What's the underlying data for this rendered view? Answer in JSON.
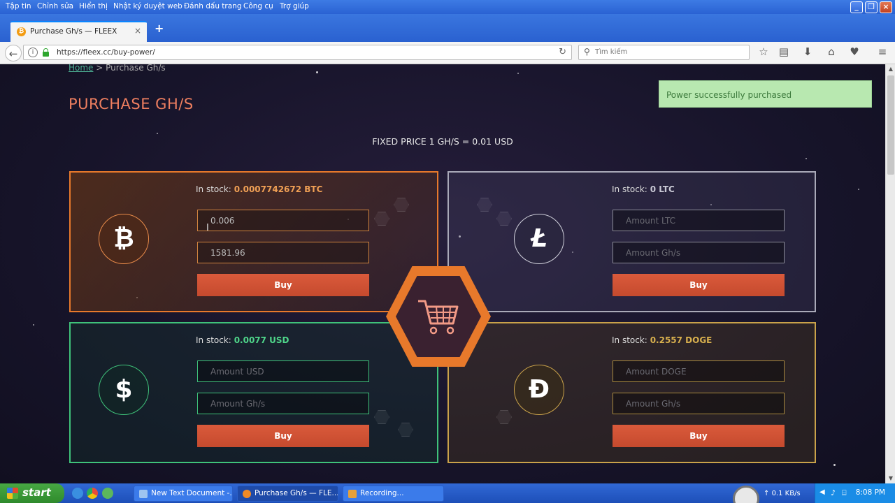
{
  "browser": {
    "menu": [
      "Tập tin",
      "Chỉnh sửa",
      "Hiển thị",
      "Nhật ký duyệt web",
      "Đánh dấu trang",
      "Công cụ",
      "Trợ giúp"
    ],
    "tab_title": "Purchase Gh/s — FLEEX",
    "url": "https://fleex.cc/buy-power/",
    "search_placeholder": "Tìm kiếm"
  },
  "page": {
    "breadcrumb_home": "Home",
    "breadcrumb_sep": ">",
    "breadcrumb_current": "Purchase Gh/s",
    "title": "PURCHASE GH/S",
    "fixed_price": "FIXED PRICE 1 GH/S = 0.01 USD",
    "toast": "Power successfully purchased"
  },
  "cards": {
    "btc": {
      "stock_label": "In stock:",
      "stock_value": "0.0007742672 BTC",
      "symbol": "₿",
      "amount_value": "0.006",
      "ghs_value": "1581.96",
      "buy_label": "Buy",
      "color": "#e8792b"
    },
    "ltc": {
      "stock_label": "In stock:",
      "stock_value": "0 LTC",
      "symbol": "Ł",
      "amount_placeholder": "Amount LTC",
      "ghs_placeholder": "Amount Gh/s",
      "buy_label": "Buy",
      "color": "#a9a9b8"
    },
    "usd": {
      "stock_label": "In stock:",
      "stock_value": "0.0077 USD",
      "symbol": "$",
      "amount_placeholder": "Amount USD",
      "ghs_placeholder": "Amount Gh/s",
      "buy_label": "Buy",
      "color": "#3fc27a"
    },
    "doge": {
      "stock_label": "In stock:",
      "stock_value": "0.2557 DOGE",
      "symbol": "Đ",
      "amount_placeholder": "Amount DOGE",
      "ghs_placeholder": "Amount Gh/s",
      "buy_label": "Buy",
      "color": "#c9a24a"
    }
  },
  "taskbar": {
    "start": "start",
    "items": [
      "New Text Document -...",
      "Purchase Gh/s — FLE...",
      "Recording..."
    ],
    "net_speed": "0.1 KB/s",
    "clock": "8:08 PM"
  },
  "colors": {
    "accent": "#ef7f60",
    "buy_button": "#d4533a"
  }
}
